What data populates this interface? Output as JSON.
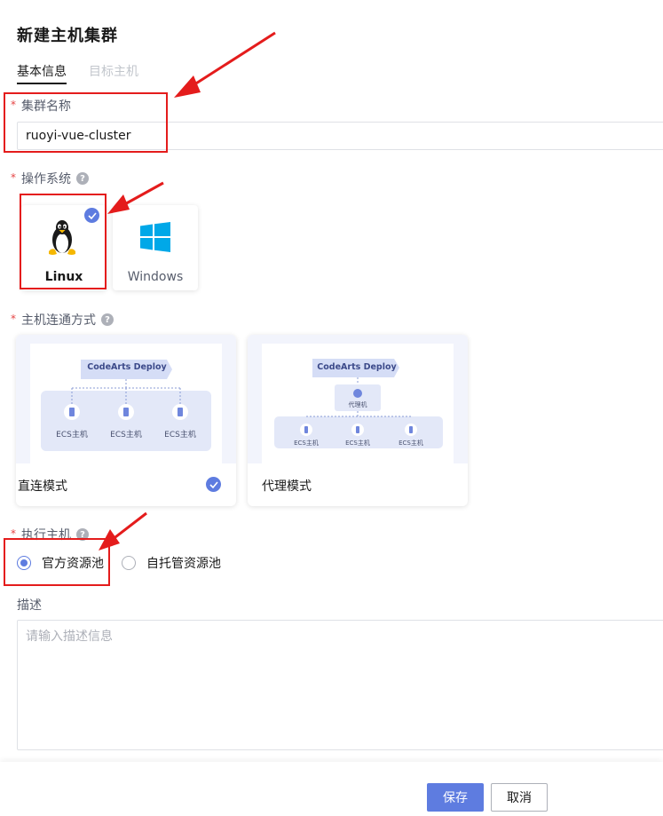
{
  "page": {
    "title": "新建主机集群"
  },
  "tabs": [
    {
      "label": "基本信息",
      "active": true
    },
    {
      "label": "目标主机",
      "active": false
    }
  ],
  "cluster_name": {
    "label": "集群名称",
    "required_mark": "*",
    "value": "ruoyi-vue-cluster"
  },
  "os": {
    "label": "操作系统",
    "help": "?",
    "options": [
      {
        "name": "Linux",
        "selected": true,
        "icon": "tux-penguin-icon"
      },
      {
        "name": "Windows",
        "selected": false,
        "icon": "windows-logo-icon"
      }
    ]
  },
  "connection": {
    "label": "主机连通方式",
    "help": "?",
    "modes": [
      {
        "name": "直连模式",
        "selected": true,
        "deploy_label": "CodeArts Deploy",
        "nodes": [
          "ECS主机",
          "ECS主机",
          "ECS主机"
        ]
      },
      {
        "name": "代理模式",
        "selected": false,
        "deploy_label": "CodeArts Deploy",
        "proxy_label": "代理机",
        "nodes": [
          "ECS主机",
          "ECS主机",
          "ECS主机"
        ]
      }
    ]
  },
  "executor": {
    "label": "执行主机",
    "help": "?",
    "options": [
      {
        "label": "官方资源池",
        "checked": true
      },
      {
        "label": "自托管资源池",
        "checked": false
      }
    ]
  },
  "description": {
    "label": "描述",
    "placeholder": "请输入描述信息"
  },
  "footer": {
    "save_label": "保存",
    "cancel_label": "取消"
  },
  "colors": {
    "accent": "#5e7ce0",
    "annotation": "#e41c1c",
    "required": "#e54545"
  }
}
